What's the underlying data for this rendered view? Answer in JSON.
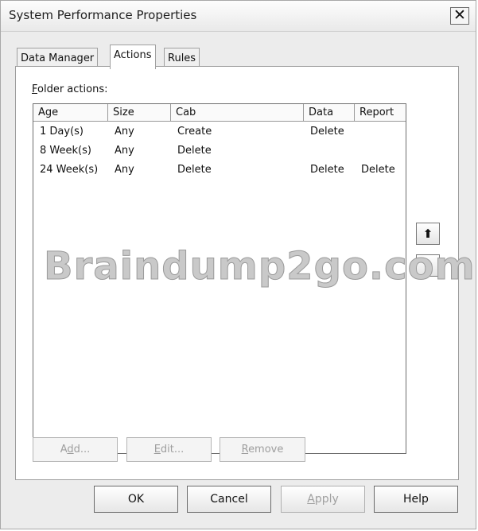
{
  "window": {
    "title": "System Performance Properties",
    "close_glyph": "✕"
  },
  "tabs": [
    {
      "label": "Data Manager",
      "active": false
    },
    {
      "label": "Actions",
      "active": true
    },
    {
      "label": "Rules",
      "active": false
    }
  ],
  "folder_actions": {
    "label_prefix": "",
    "label_access": "F",
    "label_rest": "older actions:",
    "columns": [
      "Age",
      "Size",
      "Cab",
      "Data",
      "Report"
    ],
    "rows": [
      [
        "1 Day(s)",
        "Any",
        "Create",
        "Delete",
        ""
      ],
      [
        "8 Week(s)",
        "Any",
        "Delete",
        "",
        ""
      ],
      [
        "24 Week(s)",
        "Any",
        "Delete",
        "Delete",
        "Delete"
      ]
    ]
  },
  "side_buttons": {
    "up_glyph": "⬆",
    "down_glyph": "⬇",
    "up_icon": "arrow-up-icon",
    "down_icon": "arrow-down-icon"
  },
  "panel_buttons": {
    "add": {
      "pre": "A",
      "access": "d",
      "post": "d...",
      "enabled": false
    },
    "edit": {
      "pre": "",
      "access": "E",
      "post": "dit...",
      "enabled": false
    },
    "remove": {
      "pre": "",
      "access": "R",
      "post": "emove",
      "enabled": false
    }
  },
  "dialog_buttons": {
    "ok": "OK",
    "cancel": "Cancel",
    "apply": {
      "pre": "",
      "access": "A",
      "post": "pply",
      "enabled": false
    },
    "help": "Help"
  },
  "watermark": "Braindump2go.com"
}
